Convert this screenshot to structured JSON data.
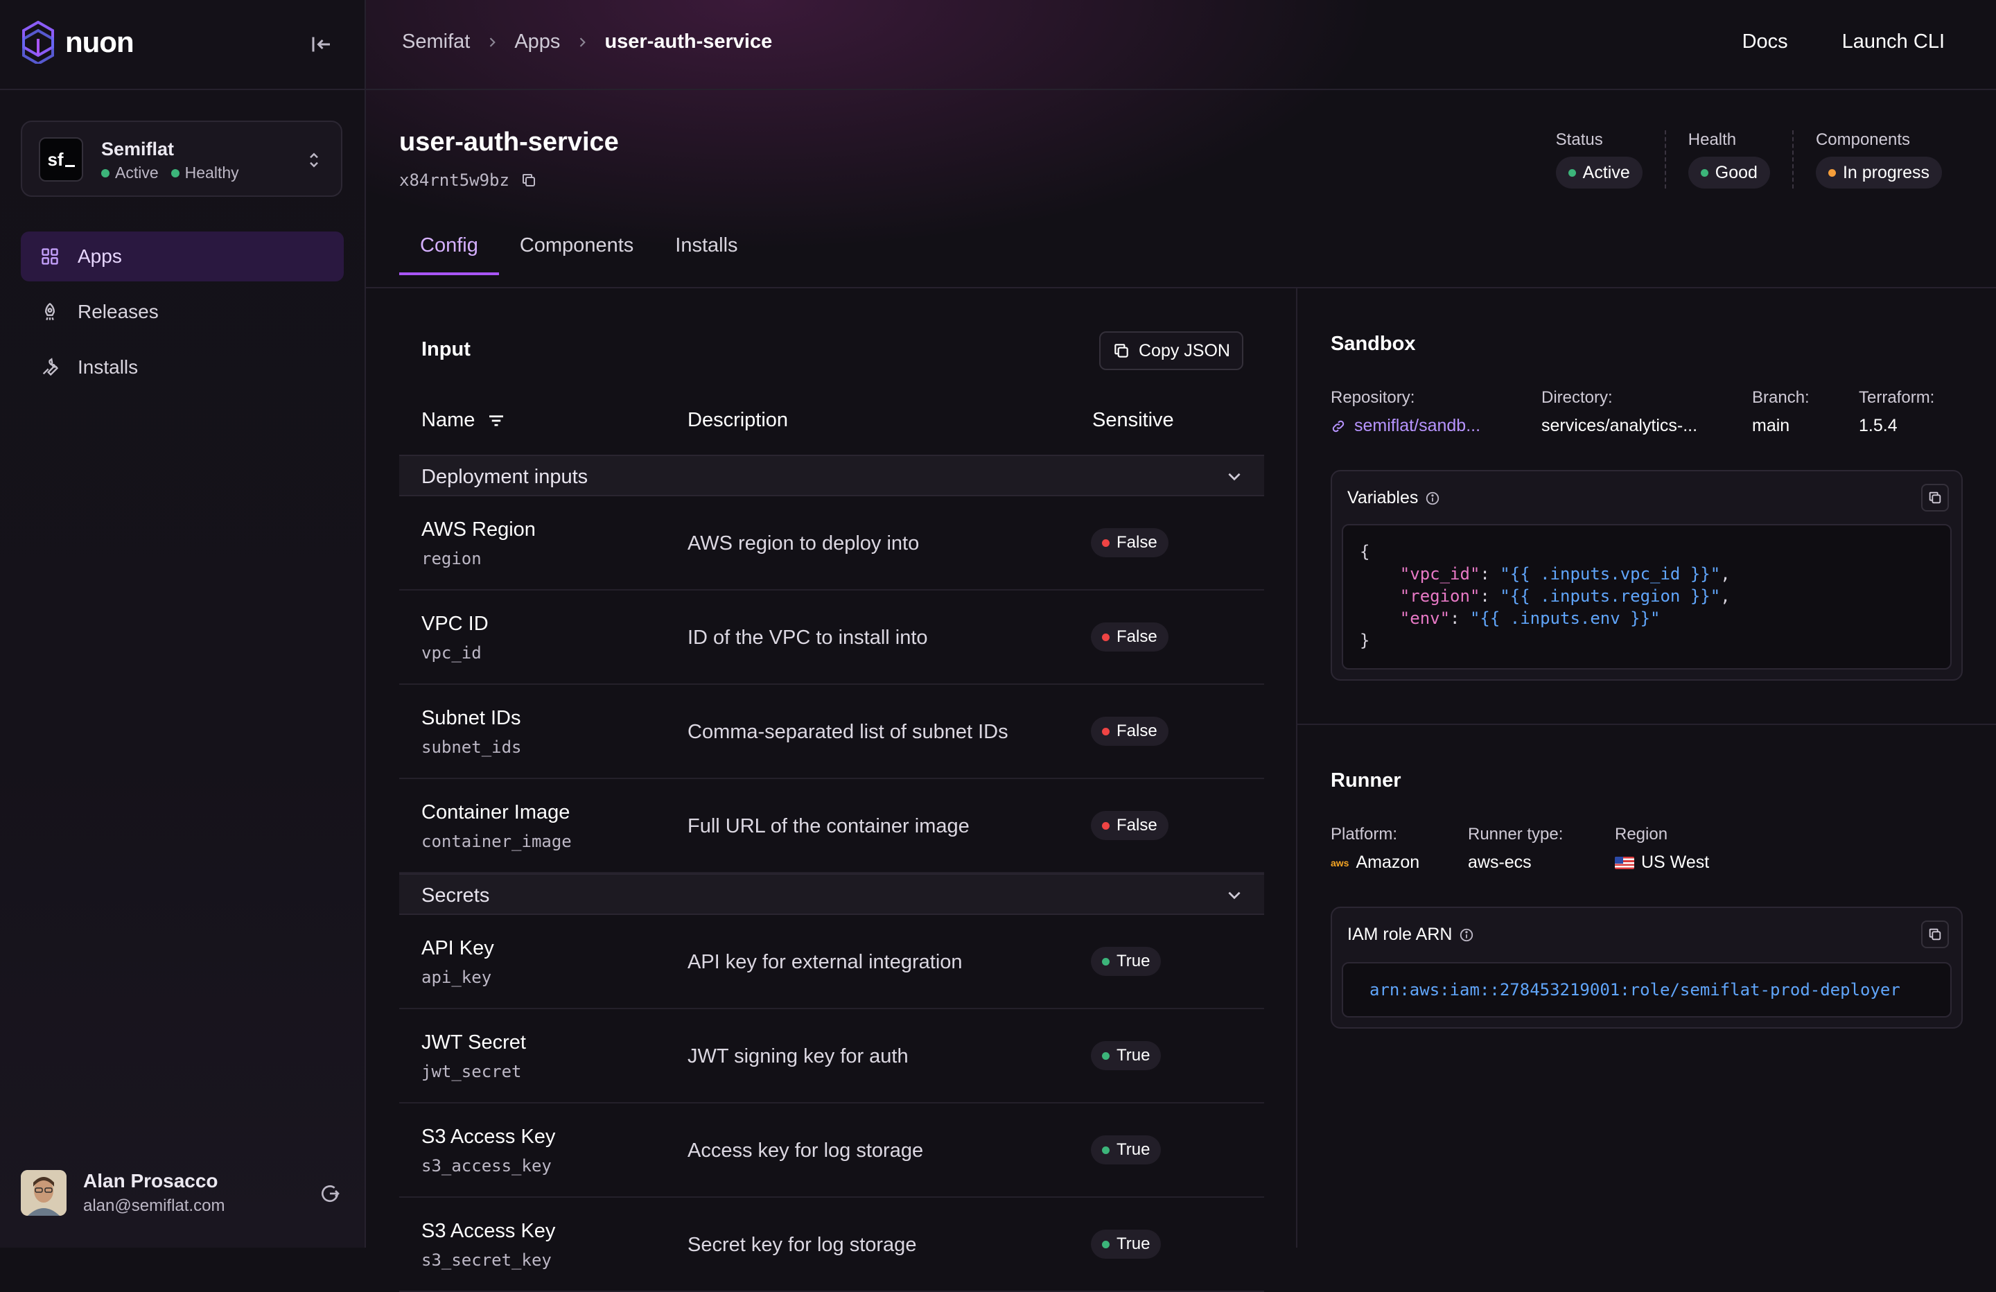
{
  "brand": {
    "name": "nuon"
  },
  "org": {
    "avatar_text": "sf",
    "name": "Semiflat",
    "status": "Active",
    "health": "Healthy"
  },
  "nav": [
    {
      "label": "Apps",
      "active": true,
      "icon": "grid-icon"
    },
    {
      "label": "Releases",
      "active": false,
      "icon": "rocket-icon"
    },
    {
      "label": "Installs",
      "active": false,
      "icon": "wrench-icon"
    }
  ],
  "user": {
    "name": "Alan Prosacco",
    "email": "alan@semiflat.com"
  },
  "breadcrumb": [
    "Semifat",
    "Apps",
    "user-auth-service"
  ],
  "header_links": {
    "docs": "Docs",
    "cli": "Launch CLI"
  },
  "app": {
    "title": "user-auth-service",
    "id": "x84rnt5w9bz"
  },
  "stats": [
    {
      "label": "Status",
      "value": "Active",
      "color": "#3cb57a"
    },
    {
      "label": "Health",
      "value": "Good",
      "color": "#3cb57a"
    },
    {
      "label": "Components",
      "value": "In progress",
      "color": "#f59e3a"
    }
  ],
  "tabs": [
    "Config",
    "Components",
    "Installs"
  ],
  "input": {
    "title": "Input",
    "copy_label": "Copy JSON",
    "columns": {
      "name": "Name",
      "description": "Description",
      "sensitive": "Sensitive"
    },
    "groups": [
      {
        "label": "Deployment inputs",
        "rows": [
          {
            "name": "AWS Region",
            "key": "region",
            "description": "AWS region to deploy into",
            "sensitive": "False"
          },
          {
            "name": "VPC ID",
            "key": "vpc_id",
            "description": "ID of the VPC to install into",
            "sensitive": "False"
          },
          {
            "name": "Subnet IDs",
            "key": "subnet_ids",
            "description": "Comma-separated list of subnet IDs",
            "sensitive": "False"
          },
          {
            "name": "Container Image",
            "key": "container_image",
            "description": "Full URL of the container image",
            "sensitive": "False"
          }
        ]
      },
      {
        "label": "Secrets",
        "rows": [
          {
            "name": "API Key",
            "key": "api_key",
            "description": "API key for external integration",
            "sensitive": "True"
          },
          {
            "name": "JWT Secret",
            "key": "jwt_secret",
            "description": "JWT signing key for auth",
            "sensitive": "True"
          },
          {
            "name": "S3 Access Key",
            "key": "s3_access_key",
            "description": "Access key for log storage",
            "sensitive": "True"
          },
          {
            "name": "S3 Access Key",
            "key": "s3_secret_key",
            "description": "Secret key for log storage",
            "sensitive": "True"
          }
        ]
      }
    ]
  },
  "sandbox": {
    "title": "Sandbox",
    "repository_label": "Repository:",
    "repository": "semiflat/sandb...",
    "directory_label": "Directory:",
    "directory": "services/analytics-...",
    "branch_label": "Branch:",
    "branch": "main",
    "terraform_label": "Terraform:",
    "terraform": "1.5.4",
    "variables_label": "Variables",
    "variables": [
      {
        "key": "\"vpc_id\"",
        "value": "\"{{ .inputs.vpc_id }}\"",
        "comma": ","
      },
      {
        "key": "\"region\"",
        "value": "\"{{ .inputs.region }}\"",
        "comma": ","
      },
      {
        "key": "\"env\"",
        "value": "\"{{ .inputs.env }}\"",
        "comma": ""
      }
    ],
    "brace_open": "{",
    "brace_close": "}"
  },
  "runner": {
    "title": "Runner",
    "platform_label": "Platform:",
    "platform": "Amazon",
    "platform_logo": "aws",
    "type_label": "Runner type:",
    "type": "aws-ecs",
    "region_label": "Region",
    "region": "US West",
    "iam_label": "IAM role ARN",
    "iam_arn": "arn:aws:iam::278453219001:role/semiflat-prod-deployer"
  }
}
